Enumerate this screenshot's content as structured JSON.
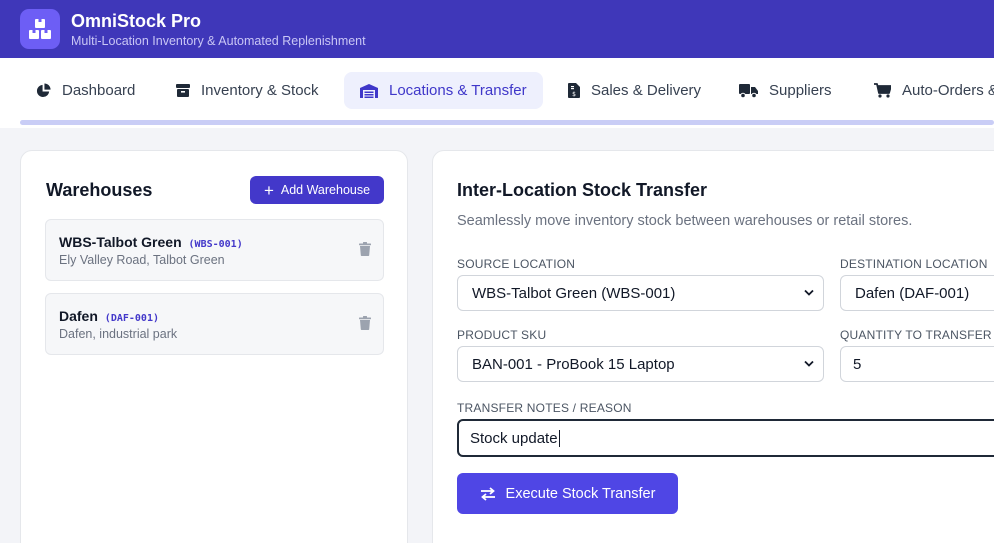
{
  "app": {
    "title": "OmniStock Pro",
    "subtitle": "Multi-Location Inventory & Automated Replenishment",
    "logo_icon": "boxes-icon"
  },
  "colors": {
    "header_bg": "#3f37b9",
    "accent": "#4338ca",
    "primary_button": "#4f46e5",
    "active_tab_bg": "#eef0fd"
  },
  "nav": {
    "tabs": [
      {
        "label": "Dashboard",
        "icon": "pie-chart-icon",
        "active": false
      },
      {
        "label": "Inventory & Stock",
        "icon": "archive-box-icon",
        "active": false
      },
      {
        "label": "Locations & Transfer",
        "icon": "warehouse-icon",
        "active": true
      },
      {
        "label": "Sales & Delivery",
        "icon": "invoice-icon",
        "active": false
      },
      {
        "label": "Suppliers",
        "icon": "truck-icon",
        "active": false
      },
      {
        "label": "Auto-Orders &",
        "icon": "cart-icon",
        "active": false
      }
    ]
  },
  "warehouses": {
    "title": "Warehouses",
    "add_label": "Add Warehouse",
    "items": [
      {
        "name": "WBS-Talbot Green",
        "code": "(WBS-001)",
        "address": "Ely Valley Road, Talbot Green"
      },
      {
        "name": "Dafen",
        "code": "(DAF-001)",
        "address": "Dafen, industrial park"
      }
    ]
  },
  "transfer": {
    "title": "Inter-Location Stock Transfer",
    "description": "Seamlessly move inventory stock between warehouses or retail stores.",
    "source_label": "SOURCE LOCATION",
    "source_value": "WBS-Talbot Green (WBS-001)",
    "destination_label": "DESTINATION LOCATION",
    "destination_value": "Dafen (DAF-001)",
    "sku_label": "PRODUCT SKU",
    "sku_value": "BAN-001 - ProBook 15 Laptop",
    "quantity_label": "QUANTITY TO TRANSFER",
    "quantity_value": "5",
    "notes_label": "TRANSFER NOTES / REASON",
    "notes_value": "Stock update",
    "execute_label": "Execute Stock Transfer"
  }
}
